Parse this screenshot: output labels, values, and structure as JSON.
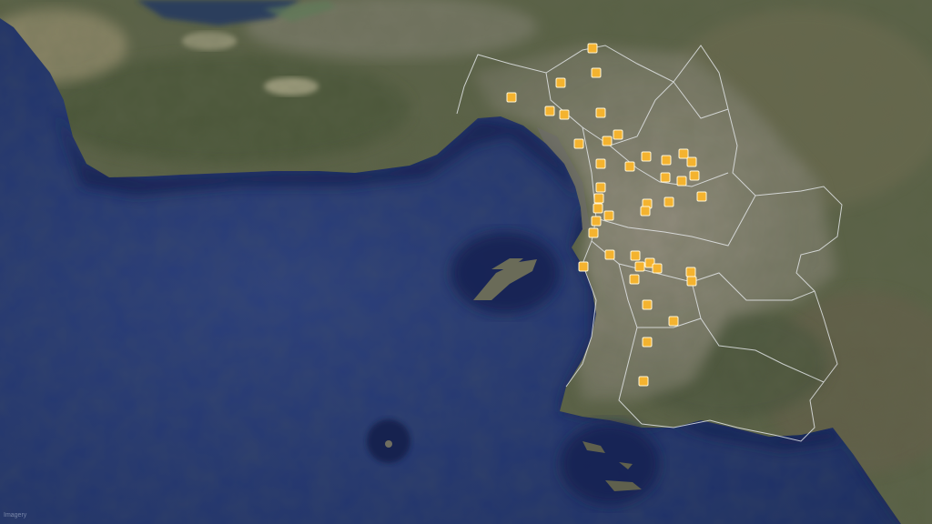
{
  "map": {
    "view": "satellite",
    "colors": {
      "sea": "#22366f",
      "land": "#5d6448",
      "urban": "#8b8a80",
      "boundary": "#e9ecef",
      "marker_fill": "#f4b32f",
      "marker_stroke": "#fff6d6"
    },
    "attribution": "Imagery",
    "marker_icon": "square-marker-icon"
  }
}
